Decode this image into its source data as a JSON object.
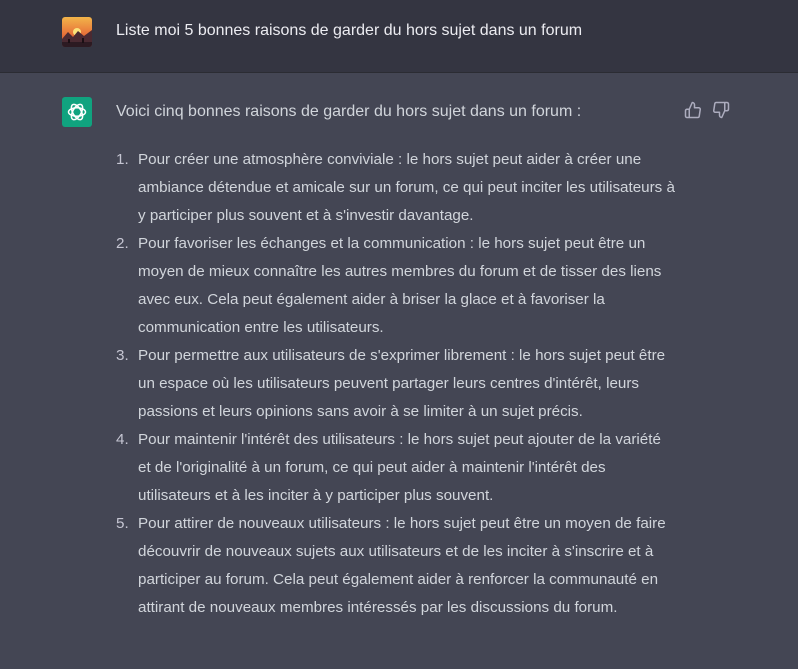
{
  "user_message": {
    "text": "Liste moi 5 bonnes raisons de garder du hors sujet dans un forum"
  },
  "assistant_message": {
    "intro": "Voici cinq bonnes raisons de garder du hors sujet dans un forum :",
    "items": [
      {
        "number": "1.",
        "text": "Pour créer une atmosphère conviviale : le hors sujet peut aider à créer une ambiance détendue et amicale sur un forum, ce qui peut inciter les utilisateurs à y participer plus souvent et à s'investir davantage."
      },
      {
        "number": "2.",
        "text": "Pour favoriser les échanges et la communication : le hors sujet peut être un moyen de mieux connaître les autres membres du forum et de tisser des liens avec eux. Cela peut également aider à briser la glace et à favoriser la communication entre les utilisateurs."
      },
      {
        "number": "3.",
        "text": "Pour permettre aux utilisateurs de s'exprimer librement : le hors sujet peut être un espace où les utilisateurs peuvent partager leurs centres d'intérêt, leurs passions et leurs opinions sans avoir à se limiter à un sujet précis."
      },
      {
        "number": "4.",
        "text": "Pour maintenir l'intérêt des utilisateurs : le hors sujet peut ajouter de la variété et de l'originalité à un forum, ce qui peut aider à maintenir l'intérêt des utilisateurs et à les inciter à y participer plus souvent."
      },
      {
        "number": "5.",
        "text": "Pour attirer de nouveaux utilisateurs : le hors sujet peut être un moyen de faire découvrir de nouveaux sujets aux utilisateurs et de les inciter à s'inscrire et à participer au forum. Cela peut également aider à renforcer la communauté en attirant de nouveaux membres intéressés par les discussions du forum."
      }
    ]
  },
  "icons": {
    "user_avatar": "sunset-avatar-icon",
    "assistant_avatar": "openai-logo-icon",
    "like": "thumbs-up-icon",
    "dislike": "thumbs-down-icon"
  },
  "colors": {
    "user_bg": "#343541",
    "assistant_bg": "#444654",
    "brand_green": "#10a37f"
  }
}
